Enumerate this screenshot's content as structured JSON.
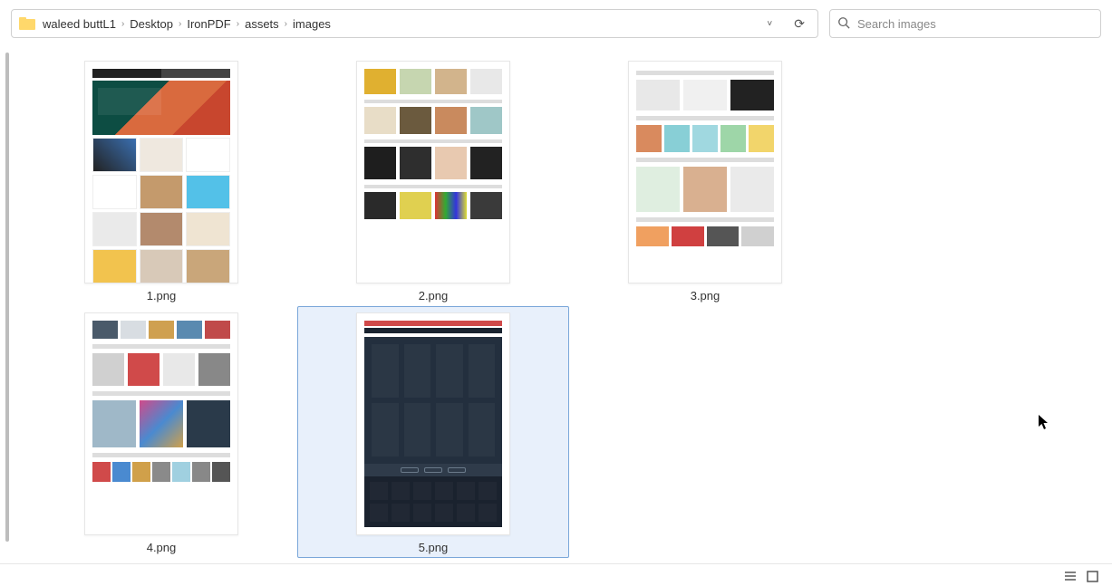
{
  "breadcrumb": {
    "segments": [
      "waleed buttL1",
      "Desktop",
      "IronPDF",
      "assets",
      "images"
    ]
  },
  "search": {
    "placeholder": "Search images"
  },
  "files": [
    {
      "name": "1.png",
      "selected": false
    },
    {
      "name": "2.png",
      "selected": false
    },
    {
      "name": "3.png",
      "selected": false
    },
    {
      "name": "4.png",
      "selected": false
    },
    {
      "name": "5.png",
      "selected": true
    }
  ]
}
